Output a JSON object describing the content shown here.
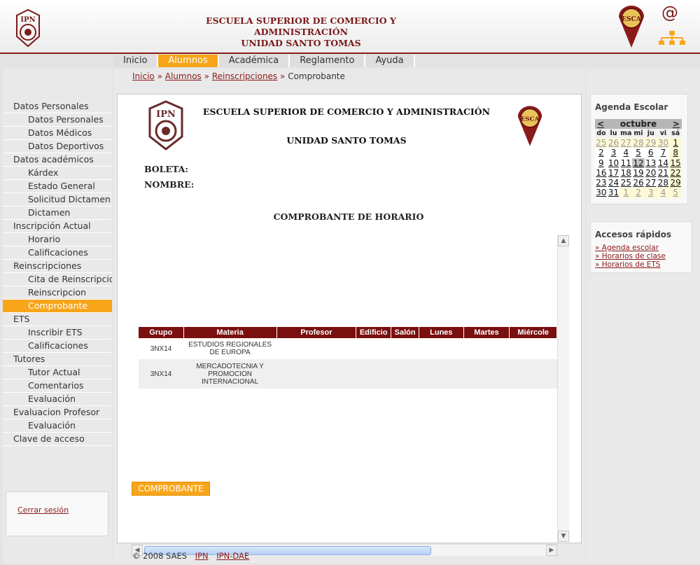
{
  "header": {
    "title_line1": "ESCUELA SUPERIOR DE COMERCIO Y ADMINISTRACIÓN",
    "title_line2": "UNIDAD SANTO TOMAS",
    "logo_text": "IPN",
    "esca_text": "ESCA",
    "email_icon": "@"
  },
  "topmenu": [
    "Inicio",
    "Alumnos",
    "Académica",
    "Reglamento",
    "Ayuda"
  ],
  "topmenu_active": 1,
  "leftmenu": [
    {
      "label": "Datos Personales",
      "level": 1
    },
    {
      "label": "Datos Personales",
      "level": 2
    },
    {
      "label": "Datos Médicos",
      "level": 2
    },
    {
      "label": "Datos Deportivos",
      "level": 2
    },
    {
      "label": "Datos académicos",
      "level": 1
    },
    {
      "label": "Kárdex",
      "level": 2
    },
    {
      "label": "Estado General",
      "level": 2
    },
    {
      "label": "Solicitud Dictamen",
      "level": 2
    },
    {
      "label": "Dictamen",
      "level": 2
    },
    {
      "label": "Inscripción Actual",
      "level": 1
    },
    {
      "label": "Horario",
      "level": 2
    },
    {
      "label": "Calificaciones",
      "level": 2
    },
    {
      "label": "Reinscripciones",
      "level": 1
    },
    {
      "label": "Cita de Reinscripcio",
      "level": 2
    },
    {
      "label": "Reinscripcion",
      "level": 2
    },
    {
      "label": "Comprobante",
      "level": 2,
      "active": true
    },
    {
      "label": "ETS",
      "level": 1
    },
    {
      "label": "Inscribir ETS",
      "level": 2
    },
    {
      "label": "Calificaciones",
      "level": 2
    },
    {
      "label": "Tutores",
      "level": 1
    },
    {
      "label": "Tutor Actual",
      "level": 2
    },
    {
      "label": "Comentarios",
      "level": 2
    },
    {
      "label": "Evaluación",
      "level": 2
    },
    {
      "label": "Evaluacion Profesor",
      "level": 1
    },
    {
      "label": "Evaluación",
      "level": 2
    },
    {
      "label": "Clave de acceso",
      "level": 1
    }
  ],
  "logout": "Cerrar sesión",
  "breadcrumb": {
    "items": [
      "Inicio",
      "Alumnos",
      "Reinscripciones"
    ],
    "current": "Comprobante",
    "separator": "»"
  },
  "document": {
    "school": "ESCUELA SUPERIOR DE COMERCIO Y ADMINISTRACIÓN",
    "unit": "UNIDAD SANTO TOMAS",
    "boleta_label": "BOLETA:",
    "nombre_label": "NOMBRE:",
    "title": "COMPROBANTE DE HORARIO"
  },
  "schedule": {
    "columns": [
      "Grupo",
      "Materia",
      "Profesor",
      "Edificio",
      "Salón",
      "Lunes",
      "Martes",
      "Miércole"
    ],
    "rows": [
      [
        "3NX14",
        "ESTUDIOS REGIONALES DE EUROPA",
        "",
        "",
        "",
        "",
        "",
        ""
      ],
      [
        "3NX14",
        "MERCADOTECNIA Y PROMOCION INTERNACIONAL",
        "",
        "",
        "",
        "",
        "",
        ""
      ]
    ]
  },
  "comprobante_button": "COMPROBANTE",
  "footer": {
    "copyright": "© 2008 SAES",
    "links": [
      "IPN",
      "IPN-DAE"
    ]
  },
  "agenda": {
    "title": "Agenda Escolar",
    "month": "octubre",
    "prev": "<",
    "next": ">",
    "weekdays": [
      "do",
      "lu",
      "ma",
      "mi",
      "ju",
      "vi",
      "sá"
    ],
    "weeks": [
      [
        "25",
        "26",
        "27",
        "28",
        "29",
        "30",
        "1"
      ],
      [
        "2",
        "3",
        "4",
        "5",
        "6",
        "7",
        "8"
      ],
      [
        "9",
        "10",
        "11",
        "12",
        "13",
        "14",
        "15"
      ],
      [
        "16",
        "17",
        "18",
        "19",
        "20",
        "21",
        "22"
      ],
      [
        "23",
        "24",
        "25",
        "26",
        "27",
        "28",
        "29"
      ],
      [
        "30",
        "31",
        "1",
        "2",
        "3",
        "4",
        "5"
      ]
    ],
    "today": "12"
  },
  "accesos": {
    "title": "Accesos rápidos",
    "links": [
      "» Agenda escolar",
      "» Horarios de clase",
      "» Horarios de ETS"
    ]
  }
}
